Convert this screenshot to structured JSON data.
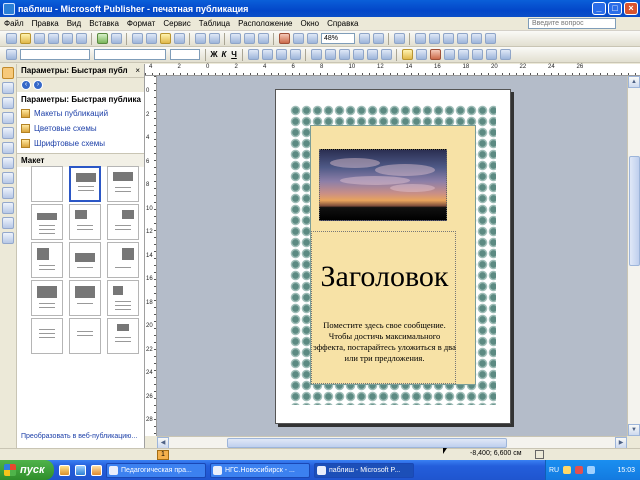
{
  "window": {
    "title": "паблиш - Microsoft Publisher - печатная публикация",
    "buttons": [
      "_",
      "□",
      "×"
    ]
  },
  "menu": {
    "items": [
      "Файл",
      "Правка",
      "Вид",
      "Вставка",
      "Формат",
      "Сервис",
      "Таблица",
      "Расположение",
      "Окно",
      "Справка"
    ],
    "help_placeholder": "Введите вопрос"
  },
  "toolbar": {
    "zoom_value": "48%",
    "font_combo": "",
    "size_combo": "",
    "style_combo": "",
    "bold_label": "Ж",
    "italic_label": "К",
    "underline_label": "Ч"
  },
  "task_pane": {
    "header": "Параметры: Быстрая публ",
    "title": "Параметры: Быстрая публика",
    "links": [
      "Макеты публикаций",
      "Цветовые схемы",
      "Шрифтовые схемы"
    ],
    "section": "Макет",
    "footer_link": "Преобразовать в веб-публикацию..."
  },
  "ruler": {
    "h_numbers": [
      "4",
      "2",
      "0",
      "2",
      "4",
      "6",
      "8",
      "10",
      "12",
      "14",
      "16",
      "18",
      "20",
      "22",
      "24",
      "26"
    ],
    "v_numbers": [
      "0",
      "2",
      "4",
      "6",
      "8",
      "10",
      "12",
      "14",
      "16",
      "18",
      "20",
      "22",
      "24",
      "26",
      "28"
    ]
  },
  "page": {
    "headline": "Заголовок",
    "message": "Поместите здесь свое сообщение. Чтобы достичь максимального эффекта, постарайтесь уложиться в два или три предложения."
  },
  "status": {
    "page_number": "1",
    "coordinates": "-8,400; 6,600 см"
  },
  "taskbar": {
    "start": "пуск",
    "tasks": [
      "Педагогическая пра...",
      "НГС.Новосибирск - ...",
      "паблиш - Microsoft P..."
    ],
    "language": "RU",
    "clock": "15:03"
  },
  "colors": {
    "title_bar": "#0347c9",
    "border_art": "#5c8a82",
    "inner_fill": "#f7e2a6",
    "workspace": "#b4bcc9"
  }
}
